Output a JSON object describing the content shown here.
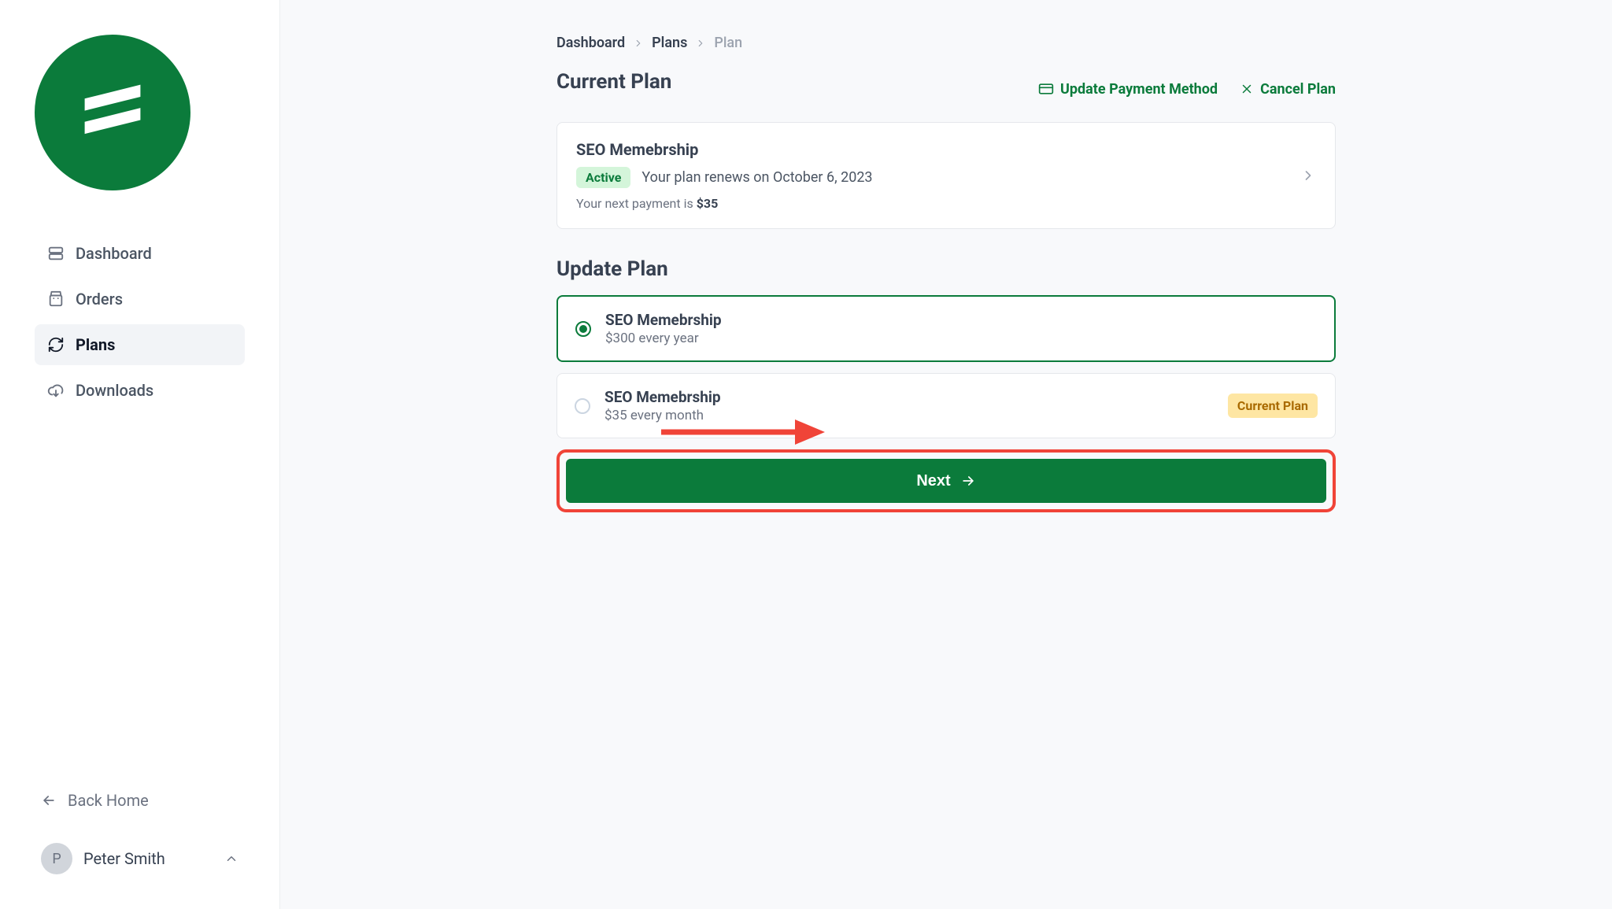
{
  "sidebar": {
    "nav": [
      {
        "label": "Dashboard",
        "name": "sidebar-item-dashboard"
      },
      {
        "label": "Orders",
        "name": "sidebar-item-orders"
      },
      {
        "label": "Plans",
        "name": "sidebar-item-plans"
      },
      {
        "label": "Downloads",
        "name": "sidebar-item-downloads"
      }
    ],
    "back_home_label": "Back Home",
    "user": {
      "initial": "P",
      "name": "Peter Smith"
    }
  },
  "breadcrumb": {
    "items": [
      {
        "label": "Dashboard"
      },
      {
        "label": "Plans"
      },
      {
        "label": "Plan"
      }
    ]
  },
  "current_plan": {
    "title": "Current Plan",
    "actions": {
      "update_payment": "Update Payment Method",
      "cancel_plan": "Cancel Plan"
    },
    "card": {
      "plan_name": "SEO Memebrship",
      "status_badge": "Active",
      "renew_text": "Your plan renews on October 6, 2023",
      "next_payment_prefix": "Your next payment is ",
      "next_payment_amount": "$35"
    }
  },
  "update_plan": {
    "title": "Update Plan",
    "options": [
      {
        "name": "SEO Memebrship",
        "price": "$300 every year",
        "selected": true,
        "current": false
      },
      {
        "name": "SEO Memebrship",
        "price": "$35 every month",
        "selected": false,
        "current": true
      }
    ],
    "current_tag": "Current Plan",
    "next_label": "Next"
  }
}
